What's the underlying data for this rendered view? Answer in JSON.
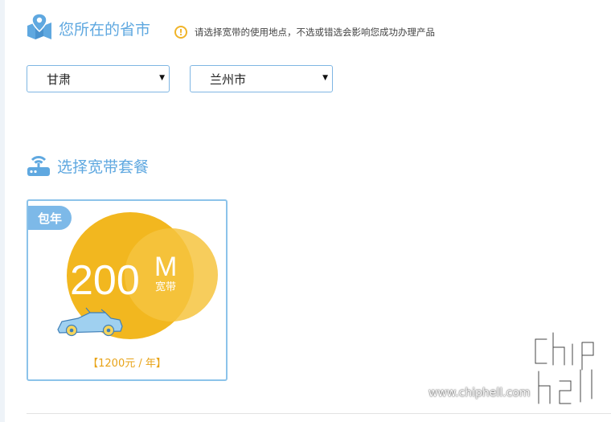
{
  "location": {
    "title": "您所在的省市",
    "notice": "请选择宽带的使用地点，不选或错选会影响您成功办理产品",
    "province_value": "甘肃",
    "city_value": "兰州市"
  },
  "packages": {
    "title": "选择宽带套餐",
    "cards": [
      {
        "badge": "包年",
        "speed": "200",
        "unit": "M",
        "unit_sub": "宽带",
        "price": "【1200元 / 年】"
      }
    ]
  },
  "watermark": {
    "text": "www.chiphell.com",
    "logo_text": "chip hell"
  },
  "colors": {
    "accent": "#5fa8e0",
    "border": "#7fb6e3",
    "warning": "#f0b429",
    "gold": "#f0b429",
    "price": "#e8a317"
  },
  "icons": {
    "location_title": "map-pin-icon",
    "notice": "warning-icon",
    "packages_title": "router-icon",
    "dropdown": "caret-down-icon",
    "car": "car-icon"
  }
}
